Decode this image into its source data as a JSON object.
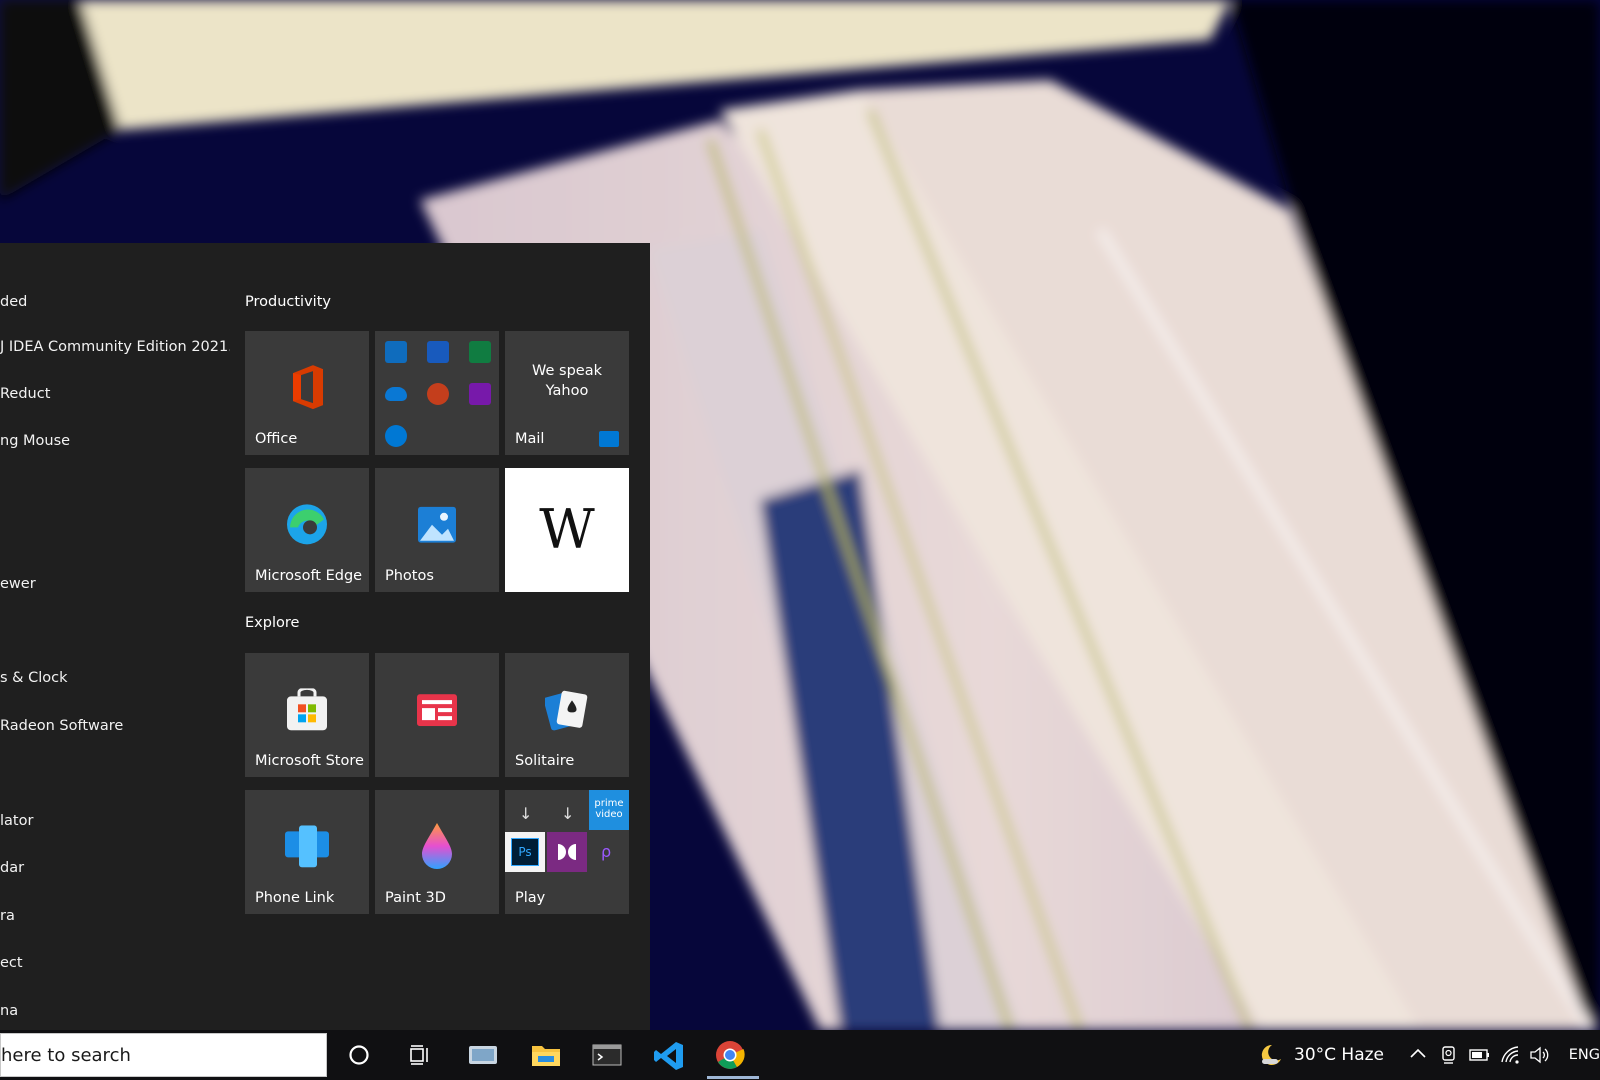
{
  "start_menu": {
    "app_list": [
      {
        "label": "ded"
      },
      {
        "label": "J IDEA Community Edition 2021...."
      },
      {
        "label": "Reduct"
      },
      {
        "label": "ng Mouse"
      },
      {
        "label": "ewer"
      },
      {
        "label": "s & Clock"
      },
      {
        "label": "Radeon Software"
      },
      {
        "label": "lator"
      },
      {
        "label": "dar"
      },
      {
        "label": "ra"
      },
      {
        "label": "ect"
      },
      {
        "label": "na"
      }
    ],
    "groups": {
      "productivity": "Productivity",
      "explore": "Explore"
    },
    "tiles": {
      "office": "Office",
      "mail_message": "We speak Yahoo",
      "mail": "Mail",
      "edge": "Microsoft Edge",
      "photos": "Photos",
      "wikipedia_letter": "W",
      "store": "Microsoft Store",
      "solitaire": "Solitaire",
      "phone_link": "Phone Link",
      "paint3d": "Paint 3D",
      "play": "Play",
      "prime_video": "prime video",
      "photoshop": "Ps"
    }
  },
  "taskbar": {
    "search_placeholder": "here to search",
    "weather": "30°C  Haze",
    "language": "ENG"
  },
  "colors": {
    "menu_bg": "#1f1f1f",
    "tile_bg": "#3a3a3a",
    "taskbar_bg": "#101012",
    "accent_blue": "#0078d4"
  }
}
